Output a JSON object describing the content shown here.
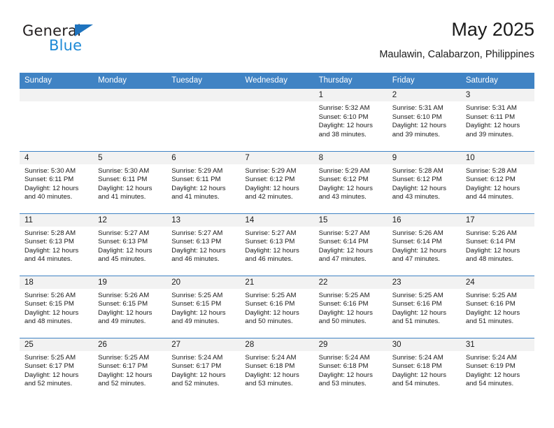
{
  "logo": {
    "word_dark": "General",
    "word_blue": "Blue",
    "triangle_color": "#1e73be",
    "blue_color": "#1e8ad6"
  },
  "header": {
    "title": "May 2025",
    "subtitle": "Maulawin, Calabarzon, Philippines"
  },
  "colors": {
    "header_blue": "#4083c4",
    "daynum_bg": "#f2f2f2",
    "text": "#1a1a1a"
  },
  "weekday_headers": [
    "Sunday",
    "Monday",
    "Tuesday",
    "Wednesday",
    "Thursday",
    "Friday",
    "Saturday"
  ],
  "weeks": [
    [
      {
        "day": "",
        "lines": []
      },
      {
        "day": "",
        "lines": []
      },
      {
        "day": "",
        "lines": []
      },
      {
        "day": "",
        "lines": []
      },
      {
        "day": "1",
        "lines": [
          "Sunrise: 5:32 AM",
          "Sunset: 6:10 PM",
          "Daylight: 12 hours",
          "and 38 minutes."
        ]
      },
      {
        "day": "2",
        "lines": [
          "Sunrise: 5:31 AM",
          "Sunset: 6:10 PM",
          "Daylight: 12 hours",
          "and 39 minutes."
        ]
      },
      {
        "day": "3",
        "lines": [
          "Sunrise: 5:31 AM",
          "Sunset: 6:11 PM",
          "Daylight: 12 hours",
          "and 39 minutes."
        ]
      }
    ],
    [
      {
        "day": "4",
        "lines": [
          "Sunrise: 5:30 AM",
          "Sunset: 6:11 PM",
          "Daylight: 12 hours",
          "and 40 minutes."
        ]
      },
      {
        "day": "5",
        "lines": [
          "Sunrise: 5:30 AM",
          "Sunset: 6:11 PM",
          "Daylight: 12 hours",
          "and 41 minutes."
        ]
      },
      {
        "day": "6",
        "lines": [
          "Sunrise: 5:29 AM",
          "Sunset: 6:11 PM",
          "Daylight: 12 hours",
          "and 41 minutes."
        ]
      },
      {
        "day": "7",
        "lines": [
          "Sunrise: 5:29 AM",
          "Sunset: 6:12 PM",
          "Daylight: 12 hours",
          "and 42 minutes."
        ]
      },
      {
        "day": "8",
        "lines": [
          "Sunrise: 5:29 AM",
          "Sunset: 6:12 PM",
          "Daylight: 12 hours",
          "and 43 minutes."
        ]
      },
      {
        "day": "9",
        "lines": [
          "Sunrise: 5:28 AM",
          "Sunset: 6:12 PM",
          "Daylight: 12 hours",
          "and 43 minutes."
        ]
      },
      {
        "day": "10",
        "lines": [
          "Sunrise: 5:28 AM",
          "Sunset: 6:12 PM",
          "Daylight: 12 hours",
          "and 44 minutes."
        ]
      }
    ],
    [
      {
        "day": "11",
        "lines": [
          "Sunrise: 5:28 AM",
          "Sunset: 6:13 PM",
          "Daylight: 12 hours",
          "and 44 minutes."
        ]
      },
      {
        "day": "12",
        "lines": [
          "Sunrise: 5:27 AM",
          "Sunset: 6:13 PM",
          "Daylight: 12 hours",
          "and 45 minutes."
        ]
      },
      {
        "day": "13",
        "lines": [
          "Sunrise: 5:27 AM",
          "Sunset: 6:13 PM",
          "Daylight: 12 hours",
          "and 46 minutes."
        ]
      },
      {
        "day": "14",
        "lines": [
          "Sunrise: 5:27 AM",
          "Sunset: 6:13 PM",
          "Daylight: 12 hours",
          "and 46 minutes."
        ]
      },
      {
        "day": "15",
        "lines": [
          "Sunrise: 5:27 AM",
          "Sunset: 6:14 PM",
          "Daylight: 12 hours",
          "and 47 minutes."
        ]
      },
      {
        "day": "16",
        "lines": [
          "Sunrise: 5:26 AM",
          "Sunset: 6:14 PM",
          "Daylight: 12 hours",
          "and 47 minutes."
        ]
      },
      {
        "day": "17",
        "lines": [
          "Sunrise: 5:26 AM",
          "Sunset: 6:14 PM",
          "Daylight: 12 hours",
          "and 48 minutes."
        ]
      }
    ],
    [
      {
        "day": "18",
        "lines": [
          "Sunrise: 5:26 AM",
          "Sunset: 6:15 PM",
          "Daylight: 12 hours",
          "and 48 minutes."
        ]
      },
      {
        "day": "19",
        "lines": [
          "Sunrise: 5:26 AM",
          "Sunset: 6:15 PM",
          "Daylight: 12 hours",
          "and 49 minutes."
        ]
      },
      {
        "day": "20",
        "lines": [
          "Sunrise: 5:25 AM",
          "Sunset: 6:15 PM",
          "Daylight: 12 hours",
          "and 49 minutes."
        ]
      },
      {
        "day": "21",
        "lines": [
          "Sunrise: 5:25 AM",
          "Sunset: 6:16 PM",
          "Daylight: 12 hours",
          "and 50 minutes."
        ]
      },
      {
        "day": "22",
        "lines": [
          "Sunrise: 5:25 AM",
          "Sunset: 6:16 PM",
          "Daylight: 12 hours",
          "and 50 minutes."
        ]
      },
      {
        "day": "23",
        "lines": [
          "Sunrise: 5:25 AM",
          "Sunset: 6:16 PM",
          "Daylight: 12 hours",
          "and 51 minutes."
        ]
      },
      {
        "day": "24",
        "lines": [
          "Sunrise: 5:25 AM",
          "Sunset: 6:16 PM",
          "Daylight: 12 hours",
          "and 51 minutes."
        ]
      }
    ],
    [
      {
        "day": "25",
        "lines": [
          "Sunrise: 5:25 AM",
          "Sunset: 6:17 PM",
          "Daylight: 12 hours",
          "and 52 minutes."
        ]
      },
      {
        "day": "26",
        "lines": [
          "Sunrise: 5:25 AM",
          "Sunset: 6:17 PM",
          "Daylight: 12 hours",
          "and 52 minutes."
        ]
      },
      {
        "day": "27",
        "lines": [
          "Sunrise: 5:24 AM",
          "Sunset: 6:17 PM",
          "Daylight: 12 hours",
          "and 52 minutes."
        ]
      },
      {
        "day": "28",
        "lines": [
          "Sunrise: 5:24 AM",
          "Sunset: 6:18 PM",
          "Daylight: 12 hours",
          "and 53 minutes."
        ]
      },
      {
        "day": "29",
        "lines": [
          "Sunrise: 5:24 AM",
          "Sunset: 6:18 PM",
          "Daylight: 12 hours",
          "and 53 minutes."
        ]
      },
      {
        "day": "30",
        "lines": [
          "Sunrise: 5:24 AM",
          "Sunset: 6:18 PM",
          "Daylight: 12 hours",
          "and 54 minutes."
        ]
      },
      {
        "day": "31",
        "lines": [
          "Sunrise: 5:24 AM",
          "Sunset: 6:19 PM",
          "Daylight: 12 hours",
          "and 54 minutes."
        ]
      }
    ]
  ]
}
